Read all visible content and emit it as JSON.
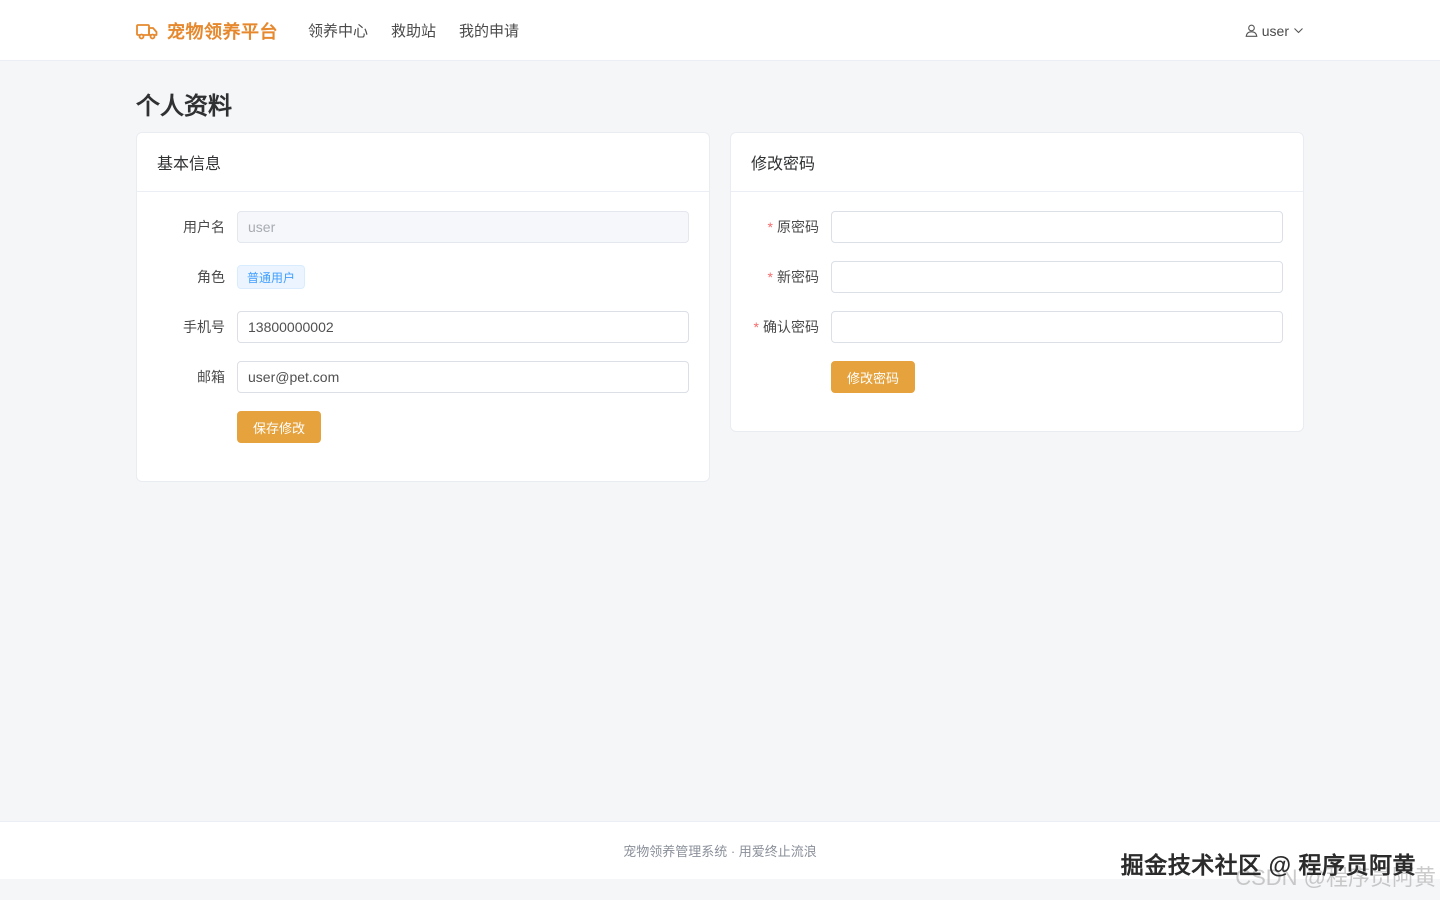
{
  "header": {
    "brand": "宠物领养平台",
    "nav": [
      "领养中心",
      "救助站",
      "我的申请"
    ],
    "user": "user"
  },
  "page": {
    "title": "个人资料"
  },
  "basic_info": {
    "title": "基本信息",
    "username_label": "用户名",
    "username_value": "user",
    "role_label": "角色",
    "role_value": "普通用户",
    "phone_label": "手机号",
    "phone_value": "13800000002",
    "email_label": "邮箱",
    "email_value": "user@pet.com",
    "save_button": "保存修改"
  },
  "change_password": {
    "title": "修改密码",
    "required_mark": "*",
    "old_label": "原密码",
    "new_label": "新密码",
    "confirm_label": "确认密码",
    "submit_button": "修改密码"
  },
  "footer": {
    "text": "宠物领养管理系统 · 用爱终止流浪"
  },
  "watermark": {
    "primary": "掘金技术社区 @ 程序员阿黄",
    "secondary": "CSDN @程序员阿黄"
  },
  "colors": {
    "brand": "#e6892e",
    "primary_button": "#e6a23c",
    "tag": "#409eff",
    "required": "#f56c6c"
  },
  "icons": {
    "brand": "truck-icon",
    "user": "user-icon",
    "dropdown": "chevron-down-icon"
  }
}
